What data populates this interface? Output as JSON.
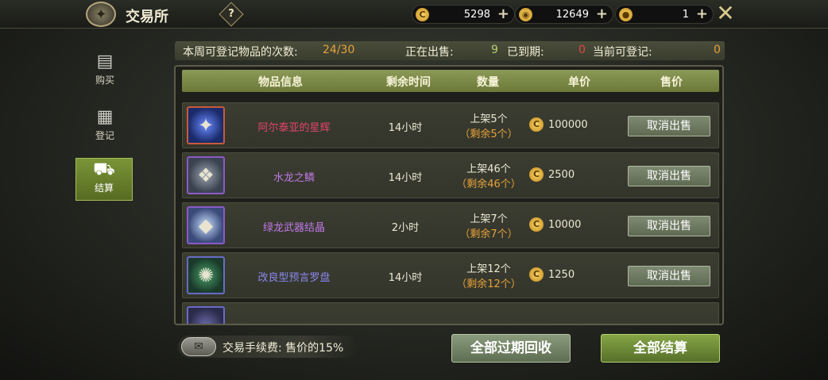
{
  "header": {
    "title": "交易所",
    "help_label": "?",
    "currencies": [
      {
        "icon": "gold-coin-icon",
        "value": "5298",
        "plus": "+"
      },
      {
        "icon": "coin-stack-icon",
        "value": "12649",
        "plus": "+"
      },
      {
        "icon": "cash-coin-icon",
        "value": "1",
        "plus": "+"
      }
    ],
    "close_icon": "close-icon"
  },
  "sidebar": {
    "items": [
      {
        "label": "购买",
        "icon": "shop-icon"
      },
      {
        "label": "登记",
        "icon": "register-icon"
      },
      {
        "label": "结算",
        "icon": "cart-icon",
        "active": true
      }
    ]
  },
  "stats": {
    "weekly_label": "本周可登记物品的次数:",
    "weekly_value": "24/30",
    "on_sale_label": "正在出售:",
    "on_sale_value": "9",
    "expired_label": "已到期:",
    "expired_value": "0",
    "available_label": "当前可登记:",
    "available_value": "0"
  },
  "table": {
    "headers": [
      "物品信息",
      "剩余时间",
      "数量",
      "单价",
      "售价"
    ],
    "rows": [
      {
        "name": "阿尔泰亚的星辉",
        "name_color": "#e0466a",
        "time": "14小时",
        "listed": "上架5个",
        "remaining": "（剩余5个）",
        "price": "100000",
        "action": "取消出售"
      },
      {
        "name": "水龙之鳞",
        "name_color": "#c07ae8",
        "time": "14小时",
        "listed": "上架46个",
        "remaining": "（剩余46个）",
        "price": "2500",
        "action": "取消出售"
      },
      {
        "name": "绿龙武器结晶",
        "name_color": "#c07ae8",
        "time": "2小时",
        "listed": "上架7个",
        "remaining": "（剩余7个）",
        "price": "10000",
        "action": "取消出售"
      },
      {
        "name": "改良型预言罗盘",
        "name_color": "#8a86ee",
        "time": "14小时",
        "listed": "上架12个",
        "remaining": "（剩余12个）",
        "price": "1250",
        "action": "取消出售"
      }
    ]
  },
  "footer": {
    "fee_text": "交易手续费: 售价的15%",
    "recover_all": "全部过期回收",
    "settle_all": "全部结算"
  },
  "colors": {
    "accent_green": "#6b7838",
    "highlight_orange": "#e6a23a",
    "value_green": "#b6d070",
    "value_red": "#e04848"
  }
}
